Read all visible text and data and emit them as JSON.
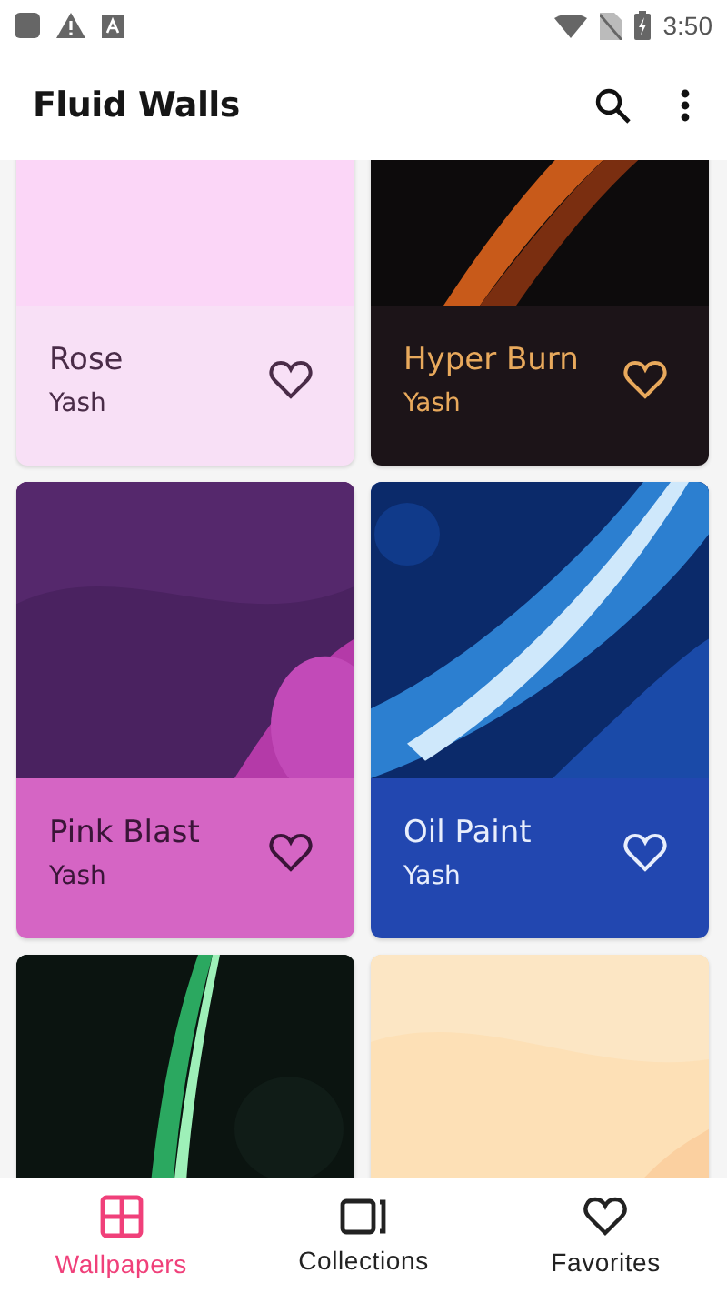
{
  "status_bar": {
    "time": "3:50"
  },
  "app_bar": {
    "title": "Fluid Walls"
  },
  "wallpapers": [
    {
      "name": "Rose",
      "author": "Yash",
      "color": "#f8e0f6",
      "favorite": false
    },
    {
      "name": "Hyper Burn",
      "author": "Yash",
      "color": "#1c1418",
      "favorite": false
    },
    {
      "name": "Pink Blast",
      "author": "Yash",
      "color": "#d565c4",
      "favorite": false
    },
    {
      "name": "Oil Paint",
      "author": "Yash",
      "color": "#2247b0",
      "favorite": false
    },
    {
      "color": "#0c1613"
    },
    {
      "color": "#fcdcb0"
    }
  ],
  "bottom_nav": [
    {
      "label": "Wallpapers",
      "selected": true
    },
    {
      "label": "Collections",
      "selected": false
    },
    {
      "label": "Favorites",
      "selected": false
    }
  ]
}
